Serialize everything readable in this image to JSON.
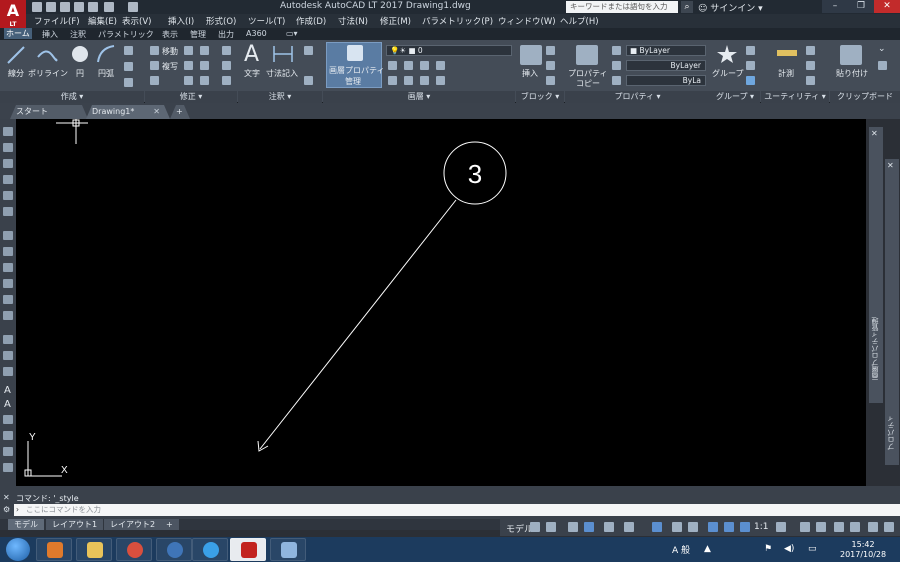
{
  "app": {
    "logo_letter": "A",
    "logo_sub": "LT",
    "title": "Autodesk AutoCAD LT 2017    Drawing1.dwg",
    "search_placeholder": "キーワードまたは語句を入力",
    "signin": "サインイン"
  },
  "menus": [
    "ファイル(F)",
    "編集(E)",
    "表示(V)",
    "挿入(I)",
    "形式(O)",
    "ツール(T)",
    "作成(D)",
    "寸法(N)",
    "修正(M)",
    "パラメトリック(P)",
    "ウィンドウ(W)",
    "ヘルプ(H)"
  ],
  "ribbon_tabs": [
    "ホーム",
    "挿入",
    "注釈",
    "パラメトリック",
    "表示",
    "管理",
    "出力",
    "A360"
  ],
  "ribbon": {
    "draw": {
      "line": "線分",
      "polyline": "ポリライン",
      "circle": "円",
      "arc": "円弧",
      "footer": "作成 ▾"
    },
    "modify": {
      "move": "移動",
      "copy": "複写",
      "footer": "修正 ▾"
    },
    "annotation": {
      "text": "文字",
      "dimension": "寸法記入",
      "footer": "注釈 ▾"
    },
    "layers": {
      "properties_l1": "画層プロパティ",
      "properties_l2": "管理",
      "layer_value": "0",
      "footer": "画層 ▾"
    },
    "block": {
      "insert": "挿入",
      "footer": "ブロック ▾"
    },
    "properties": {
      "match_l1": "プロパティ",
      "match_l2": "コピー",
      "color": "ByLayer",
      "linetype": "ByLayer",
      "lineweight": "ByLa",
      "footer": "プロパティ ▾"
    },
    "groups": {
      "group": "グループ",
      "footer": "グループ ▾"
    },
    "utilities": {
      "measure": "計測",
      "footer": "ユーティリティ ▾"
    },
    "clipboard": {
      "paste": "貼り付け",
      "footer": "クリップボード"
    }
  },
  "doc_tabs": {
    "start": "スタート",
    "drawing": "Drawing1*",
    "add": "+"
  },
  "canvas": {
    "balloon_number": "3",
    "ucs_x": "X",
    "ucs_y": "Y"
  },
  "palettes": {
    "layer_palette": "画層プロパティ管理",
    "properties_palette": "プロパティ"
  },
  "command": {
    "history": "コマンド:  '_style",
    "placeholder": "ここにコマンドを入力"
  },
  "layout_tabs": [
    "モデル",
    "レイアウト1",
    "レイアウト2",
    "+"
  ],
  "status": {
    "model": "モデル",
    "scale": "1:1"
  },
  "taskbar": {
    "ime": "A 般",
    "time": "15:42",
    "date": "2017/10/28"
  },
  "colors": {
    "canvas": "#000000",
    "ribbon": "#444c57",
    "accent": "#46607a",
    "taskbar": "#1c3b5e"
  }
}
